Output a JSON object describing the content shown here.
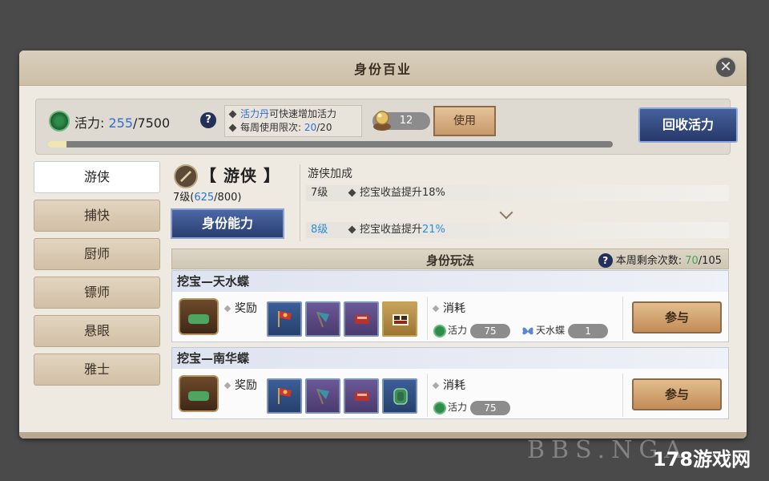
{
  "panel": {
    "title": "身份百业"
  },
  "energy": {
    "label": "活力:",
    "current": "255",
    "max": "/7500",
    "help": "?",
    "progress": 0.034
  },
  "tips": {
    "line1_highlight": "活力丹",
    "line1_rest": "可快速增加活力",
    "line2_prefix": "每周使用限次: ",
    "line2_cur": "20",
    "line2_max": "/20"
  },
  "item": {
    "count": "12",
    "use_label": "使用"
  },
  "recycle_label": "回收活力",
  "sidebar": {
    "items": [
      {
        "label": "游侠",
        "active": true
      },
      {
        "label": "捕快"
      },
      {
        "label": "厨师"
      },
      {
        "label": "镖师"
      },
      {
        "label": "悬眼"
      },
      {
        "label": "雅士"
      }
    ]
  },
  "identity": {
    "name": "【 游侠 】",
    "level_prefix": "7级(",
    "level_cur": "625",
    "level_rest": "/800)",
    "ability_label": "身份能力"
  },
  "bonus": {
    "title": "游侠加成",
    "current": {
      "level": "7级",
      "text": "挖宝收益提升18%"
    },
    "next": {
      "level": "8级",
      "text_prefix": "挖宝收益提升",
      "text_num": "21%"
    }
  },
  "gameplay": {
    "title": "身份玩法",
    "remain_label": "本周剩余次数: ",
    "remain_cur": "70",
    "remain_max": "/105",
    "reward_label": "奖励",
    "cost_label": "消耗",
    "join_label": "参与",
    "activities": [
      {
        "title": "挖宝—天水蝶",
        "rewards": [
          "red-flag-icon",
          "blue-flag-icon",
          "red-scroll-icon",
          "gold-box-icon"
        ],
        "costs": [
          {
            "icon": "energy-icon",
            "name": "活力",
            "value": "75"
          },
          {
            "icon": "butterfly-icon",
            "name": "天水蝶",
            "value": "1"
          }
        ]
      },
      {
        "title": "挖宝—南华蝶",
        "rewards": [
          "red-flag-icon",
          "blue-flag-icon",
          "red-scroll-icon",
          "green-token-icon"
        ],
        "costs": [
          {
            "icon": "energy-icon",
            "name": "活力",
            "value": "75"
          }
        ]
      }
    ]
  },
  "watermark": {
    "left": "BBS.NGA",
    "right": "178游戏网"
  }
}
